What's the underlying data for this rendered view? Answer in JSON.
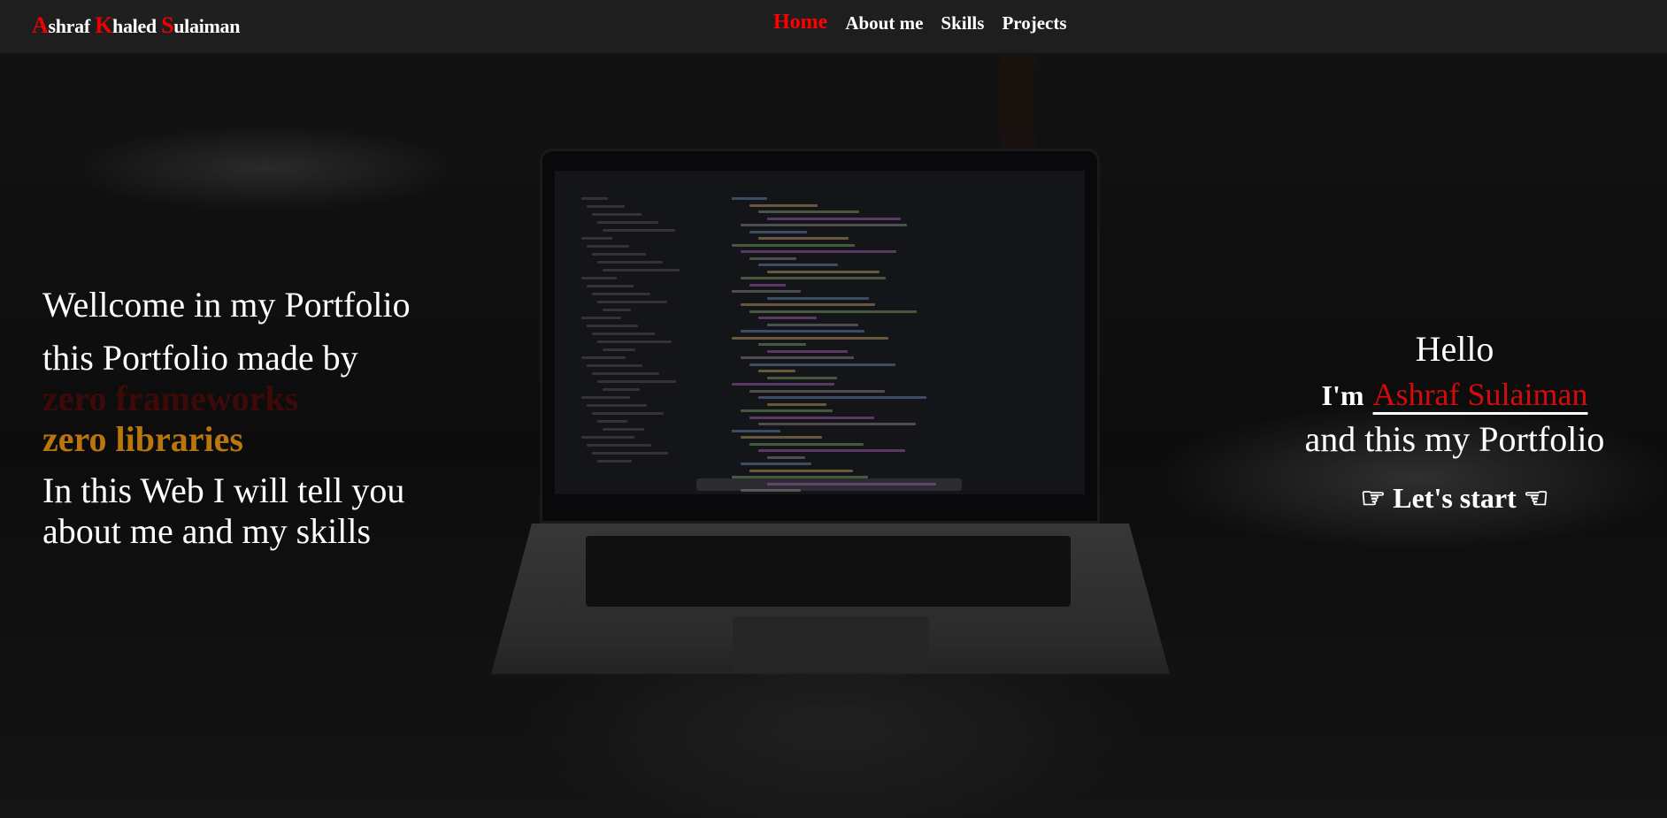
{
  "nav": {
    "logo": [
      {
        "initial": "A",
        "rest": "shraf "
      },
      {
        "initial": "K",
        "rest": "haled "
      },
      {
        "initial": "S",
        "rest": "ulaiman"
      }
    ],
    "links": [
      "Home",
      "About me",
      "Skills",
      "Projects"
    ],
    "active": "Home"
  },
  "intro": {
    "line1": "Wellcome in my Portfolio",
    "line2": "this Portfolio made by",
    "frameworks": "zero frameworks",
    "libraries": "zero libraries",
    "line5": "In this Web I will tell you",
    "line6": "about me and my skills"
  },
  "greeting": {
    "hello": "Hello",
    "im": "I'm",
    "name": "Ashraf Sulaiman",
    "line3": "and this my Portfolio",
    "cta": "Let's start",
    "icon_left": "hand-pointing-right-icon",
    "icon_right": "hand-pointing-left-icon"
  },
  "colors": {
    "accent": "#ff0000",
    "name": "#d40b0b",
    "frameworks": "#3d0909",
    "libraries": "#b8760c"
  }
}
